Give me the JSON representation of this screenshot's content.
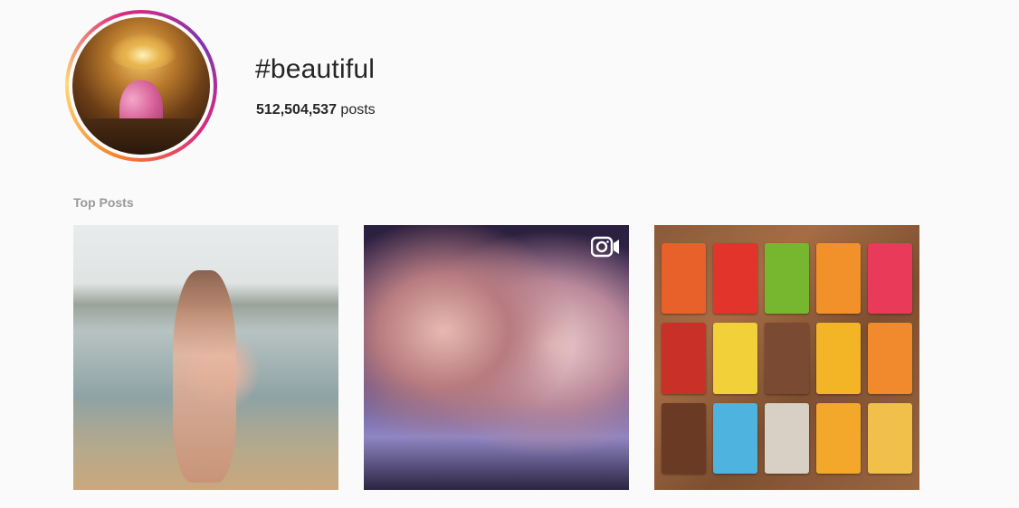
{
  "header": {
    "hashtag": "#beautiful",
    "post_count": "512,504,537",
    "post_count_suffix": " posts"
  },
  "sections": {
    "top_posts_label": "Top Posts"
  },
  "posts": [
    {
      "kind": "photo"
    },
    {
      "kind": "video",
      "icon": "video-camera-icon"
    },
    {
      "kind": "photo"
    }
  ],
  "pack_colors": [
    "#e8602a",
    "#e2342a",
    "#77b72f",
    "#f2902a",
    "#e93a59",
    "#c93128",
    "#f1d03a",
    "#7b4a33",
    "#f3b526",
    "#f08a2c",
    "#6a3a25",
    "#4fb3e0",
    "#d8d0c4",
    "#f3a82c",
    "#f0c04a"
  ],
  "colors": {
    "text": "#262626",
    "muted": "#999999",
    "background": "#fafafa"
  }
}
